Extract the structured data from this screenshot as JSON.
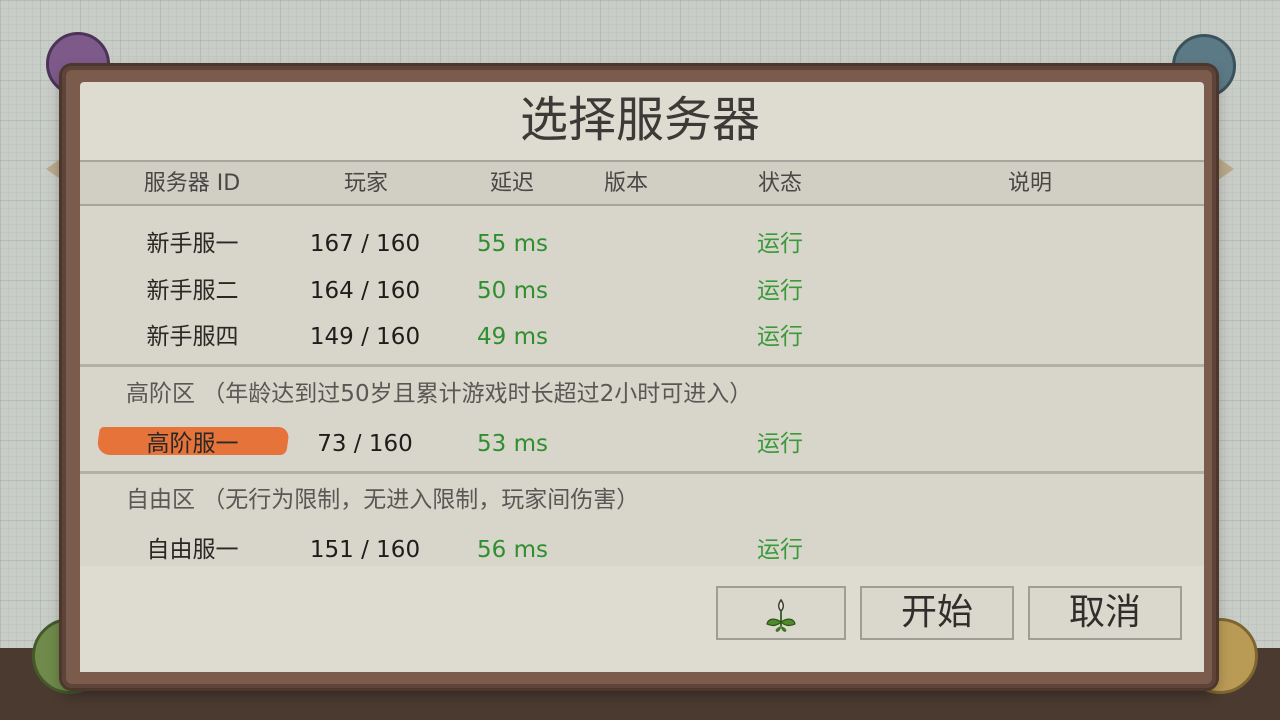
{
  "dialog": {
    "title": "选择服务器"
  },
  "columns": {
    "server_id": "服务器 ID",
    "players": "玩家",
    "latency": "延迟",
    "version": "版本",
    "status": "状态",
    "description": "说明"
  },
  "servers": [
    {
      "name": "新手服一",
      "players": "167 / 160",
      "latency": "55 ms",
      "status": "运行"
    },
    {
      "name": "新手服二",
      "players": "164 / 160",
      "latency": "50 ms",
      "status": "运行"
    },
    {
      "name": "新手服四",
      "players": "149 / 160",
      "latency": "49 ms",
      "status": "运行"
    }
  ],
  "sections": [
    {
      "title": "高阶区 （年龄达到过50岁且累计游戏时长超过2小时可进入）",
      "servers": [
        {
          "name": "高阶服一",
          "players": "73 / 160",
          "latency": "53 ms",
          "status": "运行",
          "selected": true
        }
      ]
    },
    {
      "title": "自由区 （无行为限制，无进入限制，玩家间伤害）",
      "servers": [
        {
          "name": "自由服一",
          "players": "151 / 160",
          "latency": "56 ms",
          "status": "运行"
        }
      ]
    }
  ],
  "buttons": {
    "plant_icon": "plant-icon",
    "start": "开始",
    "cancel": "取消"
  },
  "colors": {
    "ping": "#2f8f2f",
    "status": "#3a9a3a",
    "highlight": "#e5733a",
    "frame": "#7a5b4c",
    "panel": "#dedbd0"
  }
}
